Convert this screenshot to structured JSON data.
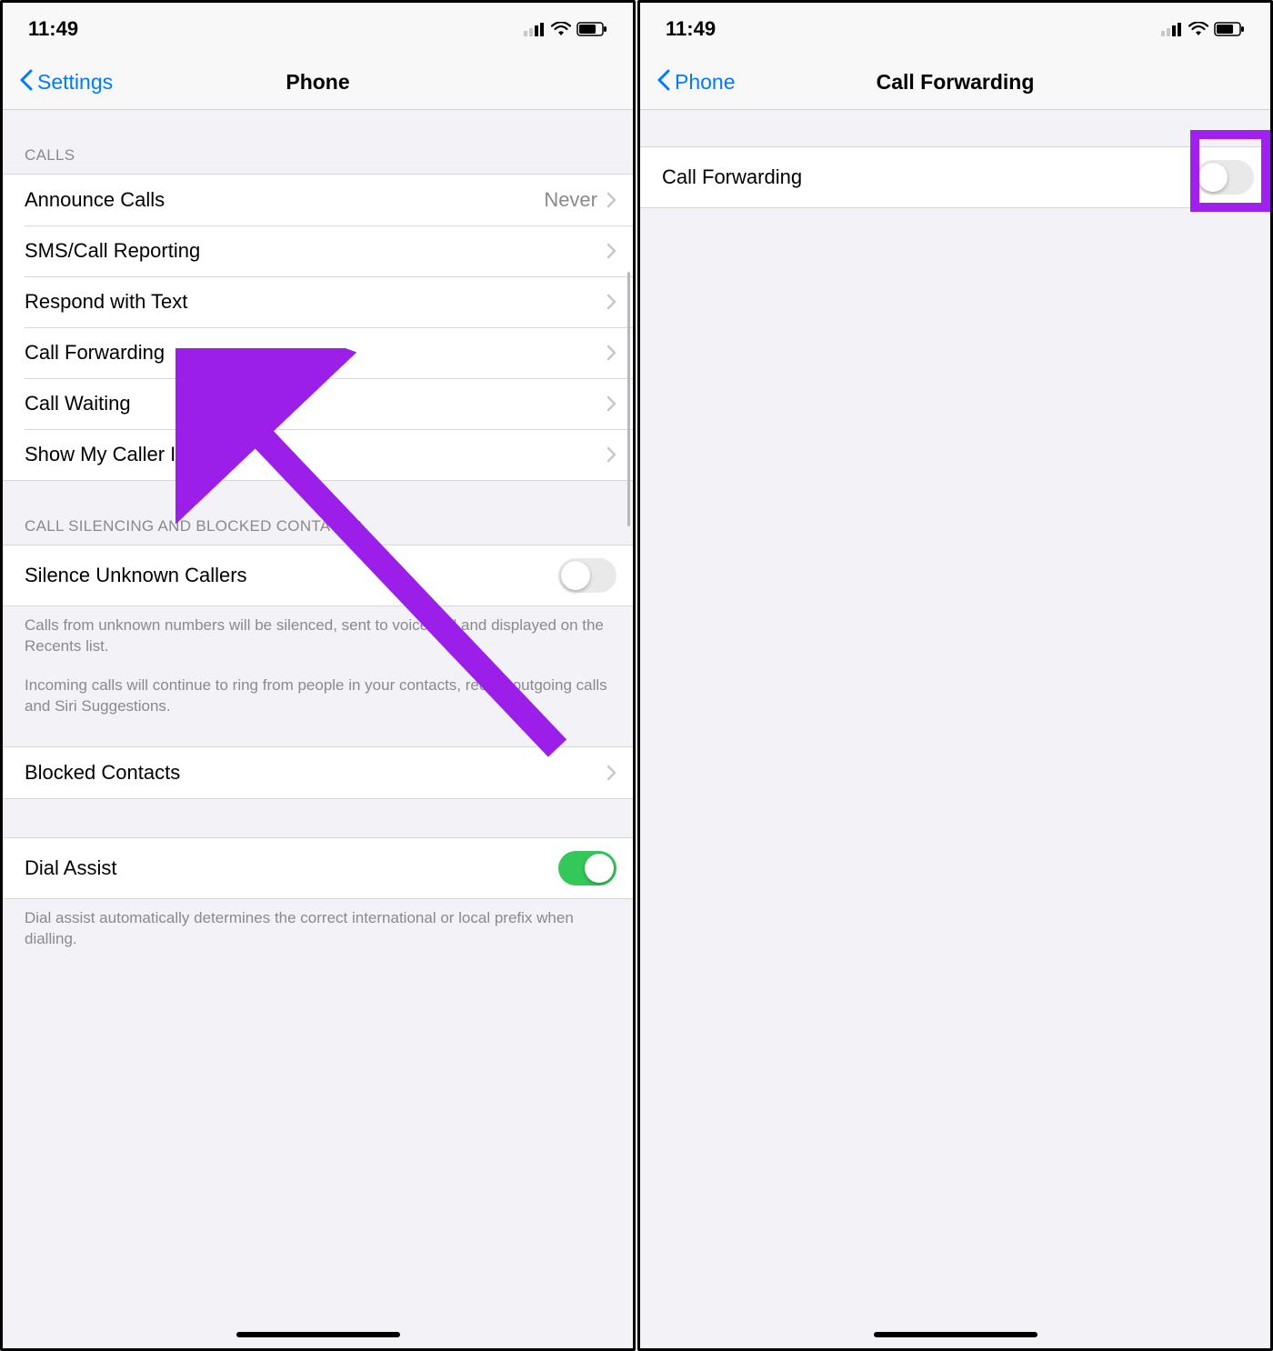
{
  "left": {
    "status": {
      "time": "11:49"
    },
    "nav": {
      "back": "Settings",
      "title": "Phone"
    },
    "calls_header": "CALLS",
    "calls": [
      {
        "label": "Announce Calls",
        "value": "Never"
      },
      {
        "label": "SMS/Call Reporting"
      },
      {
        "label": "Respond with Text"
      },
      {
        "label": "Call Forwarding"
      },
      {
        "label": "Call Waiting"
      },
      {
        "label": "Show My Caller ID"
      }
    ],
    "silence_header": "CALL SILENCING AND BLOCKED CONTACTS",
    "silence_label": "Silence Unknown Callers",
    "silence_footer1": "Calls from unknown numbers will be silenced, sent to voicemail and displayed on the Recents list.",
    "silence_footer2": "Incoming calls will continue to ring from people in your contacts, recent outgoing calls and Siri Suggestions.",
    "blocked_label": "Blocked Contacts",
    "dial_assist_label": "Dial Assist",
    "dial_assist_footer": "Dial assist automatically determines the correct international or local prefix when dialling."
  },
  "right": {
    "status": {
      "time": "11:49"
    },
    "nav": {
      "back": "Phone",
      "title": "Call Forwarding"
    },
    "cf_label": "Call Forwarding"
  }
}
